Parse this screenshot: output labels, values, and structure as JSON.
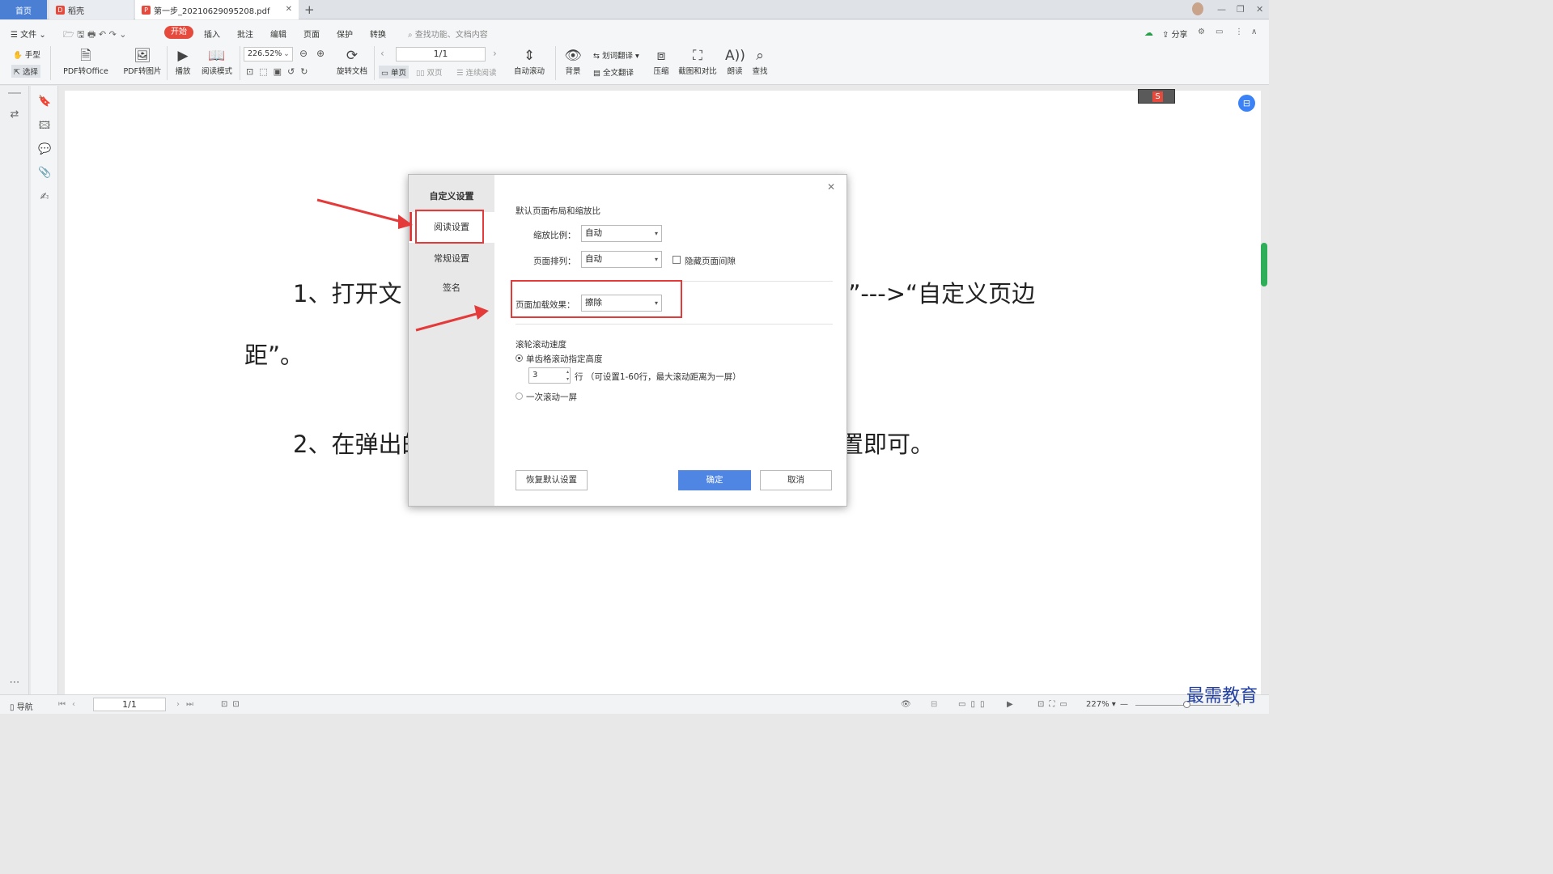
{
  "tabs": {
    "home": "首页",
    "shell": "稻壳",
    "document": "第一步_20210629095208.pdf"
  },
  "menu": {
    "file": "文件",
    "start": "开始",
    "insert": "插入",
    "annotate": "批注",
    "edit": "编辑",
    "page": "页面",
    "protect": "保护",
    "convert": "转换",
    "search_placeholder": "查找功能、文档内容",
    "share": "分享"
  },
  "ribbon": {
    "hand": "手型",
    "select": "选择",
    "pdf_to_office": "PDF转Office",
    "pdf_to_image": "PDF转图片",
    "play": "播放",
    "read_mode": "阅读模式",
    "zoom": "226.52%",
    "rotate": "旋转文档",
    "page_num": "1/1",
    "single": "单页",
    "double": "双页",
    "continuous": "连续阅读",
    "autoscroll": "自动滚动",
    "background": "背景",
    "word_translate": "划词翻译",
    "full_translate": "全文翻译",
    "compress": "压缩",
    "screenshot_compare": "截图和对比",
    "read_aloud": "朗读",
    "find": "查找"
  },
  "document": {
    "line1a": "1、打开文",
    "line1b": "E”--->“自定义页边",
    "line2": "距”。",
    "line3a": "2、在弹出的",
    "line3b": "置即可。"
  },
  "dialog": {
    "title": "自定义设置",
    "nav": [
      "阅读设置",
      "常规设置",
      "签名"
    ],
    "section_layout": "默认页面布局和缩放比",
    "zoom_label": "缩放比例：",
    "zoom_value": "自动",
    "arrange_label": "页面排列：",
    "arrange_value": "自动",
    "hide_gap": "隐藏页面间隙",
    "load_effect_label": "页面加载效果：",
    "load_effect_value": "擦除",
    "scroll_title": "滚轮滚动速度",
    "radio1": "单齿格滚动指定高度",
    "lines_value": "3",
    "lines_hint": "行 （可设置1-60行，最大滚动距离为一屏）",
    "radio2": "一次滚动一屏",
    "restore": "恢复默认设置",
    "ok": "确定",
    "cancel": "取消"
  },
  "status": {
    "nav": "导航",
    "page": "1/1",
    "zoom": "227%"
  },
  "watermark": "最需教育",
  "colors": {
    "accent": "#4a7fd4",
    "start_tab": "#e64a3c",
    "highlight": "#e43a3a",
    "ok_button": "#4f86e4"
  }
}
